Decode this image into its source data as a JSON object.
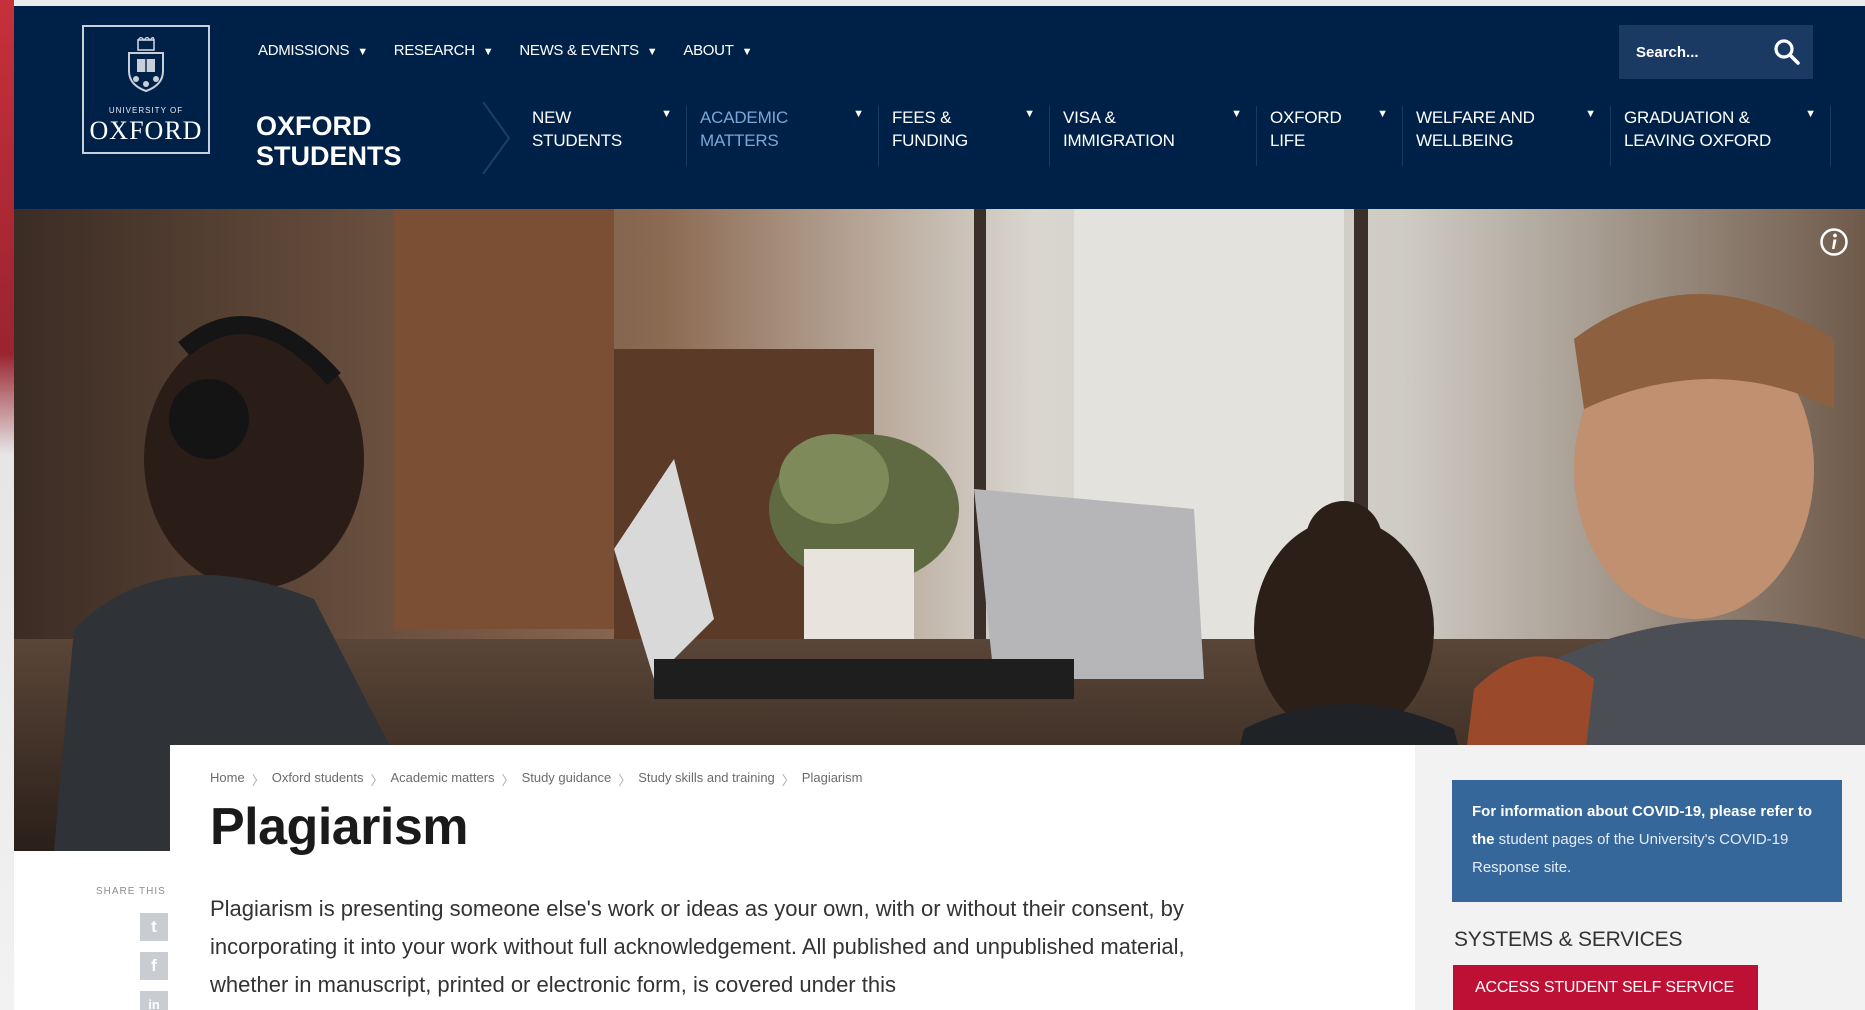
{
  "header": {
    "logo": {
      "university": "UNIVERSITY OF",
      "name": "OXFORD"
    },
    "top_nav": [
      {
        "label": "ADMISSIONS"
      },
      {
        "label": "RESEARCH"
      },
      {
        "label": "NEWS & EVENTS"
      },
      {
        "label": "ABOUT"
      }
    ],
    "search": {
      "placeholder": "Search..."
    },
    "site_title_line1": "OXFORD",
    "site_title_line2": "STUDENTS",
    "main_nav": [
      {
        "label": "New students",
        "active": false
      },
      {
        "label": "Academic matters",
        "active": true
      },
      {
        "label": "Fees & funding",
        "active": false
      },
      {
        "label": "Visa & immigration",
        "active": false
      },
      {
        "label": "Oxford life",
        "active": false
      },
      {
        "label": "Welfare and wellbeing",
        "active": false
      },
      {
        "label": "Graduation & leaving Oxford",
        "active": false
      }
    ]
  },
  "breadcrumb": [
    "Home",
    "Oxford students",
    "Academic matters",
    "Study guidance",
    "Study skills and training",
    "Plagiarism"
  ],
  "page": {
    "title": "Plagiarism",
    "intro": "Plagiarism is presenting someone else's work or ideas as your own, with or without their consent, by incorporating it into your work without full acknowledgement. All published and unpublished material, whether in manuscript, printed or electronic form, is covered under this"
  },
  "share": {
    "label": "SHARE THIS",
    "icons": [
      {
        "name": "twitter-icon",
        "glyph": "t"
      },
      {
        "name": "facebook-icon",
        "glyph": "f"
      },
      {
        "name": "linkedin-icon",
        "glyph": "in"
      }
    ]
  },
  "sidebar": {
    "covid_bold": "For information about COVID-19, please refer to the",
    "covid_link": "student pages of the University's COVID-19 Response site.",
    "systems_heading": "Systems & services",
    "self_service_button": "Access student self service"
  },
  "colors": {
    "header_bg": "#002147",
    "active_nav": "#7aa6d8",
    "covid_box": "#36679a",
    "self_service_button": "#be0f34"
  }
}
